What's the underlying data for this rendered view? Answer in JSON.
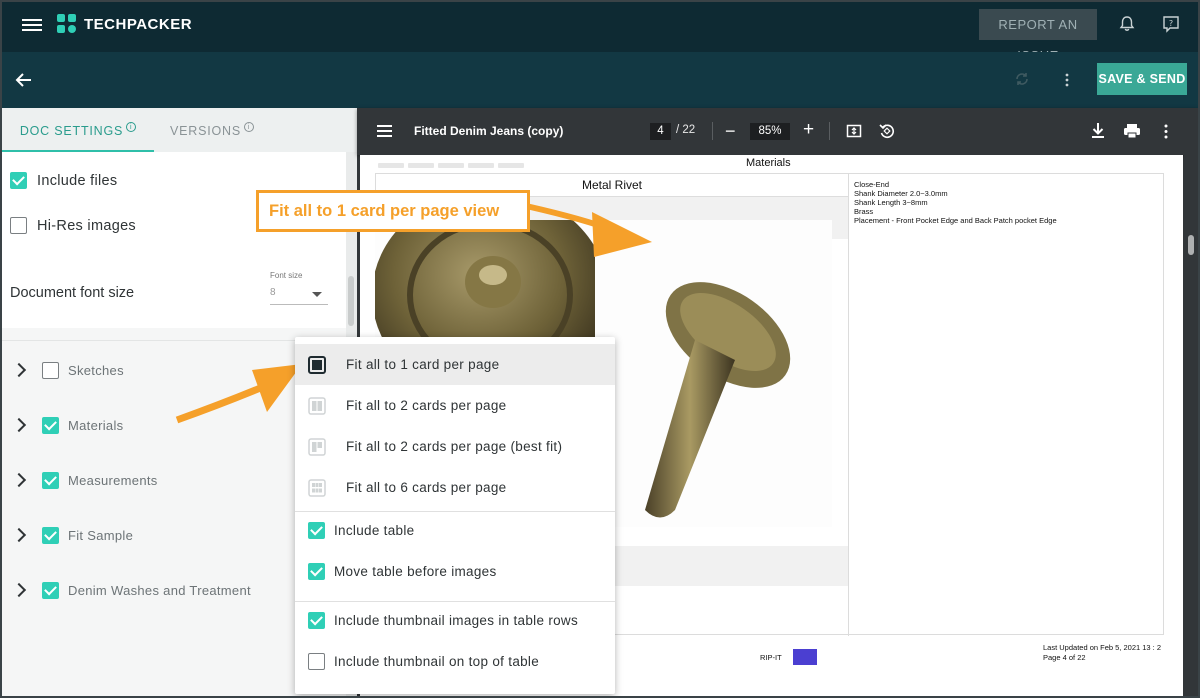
{
  "app": {
    "brand": "TECHPACKER",
    "report_label": "REPORT AN ISSUE",
    "save_label": "SAVE & SEND"
  },
  "tabs": [
    {
      "label": "DOC SETTINGS",
      "active": true
    },
    {
      "label": "VERSIONS",
      "active": false
    }
  ],
  "settings": {
    "include_files": {
      "label": "Include files",
      "checked": true
    },
    "hires_images": {
      "label": "Hi-Res images",
      "checked": false
    },
    "font_size_label": "Document font size",
    "font_size_caption": "Font size",
    "font_size_value": "8"
  },
  "sections": [
    {
      "label": "Sketches",
      "checked": false
    },
    {
      "label": "Materials",
      "checked": true
    },
    {
      "label": "Measurements",
      "checked": true
    },
    {
      "label": "Fit Sample",
      "checked": true
    },
    {
      "label": "Denim Washes and Treatment",
      "checked": true
    }
  ],
  "viewer": {
    "title": "Fitted Denim Jeans (copy)",
    "page_current": "4",
    "page_total": "/ 22",
    "zoom": "85%",
    "minus": "−",
    "plus": "+"
  },
  "document": {
    "section_title": "Materials",
    "item_name": "Metal Rivet",
    "specs": [
      "Close-End",
      "Shank Diameter 2.0~3.0mm",
      "Shank Length 3~8mm",
      "Brass",
      "Placement - Front Pocket Edge and Back Patch pocket Edge"
    ],
    "footer_brand": "RIP-IT",
    "footer_updated": "Last Updated on Feb 5, 2021 13 : 2",
    "footer_page": "Page 4 of 22"
  },
  "annotation": {
    "text": "Fit all to 1 card per page view",
    "color": "#f5a02a"
  },
  "dropdown": {
    "layouts": [
      {
        "label": "Fit all to 1 card per page",
        "selected": true
      },
      {
        "label": "Fit all to 2 cards per page",
        "selected": false
      },
      {
        "label": "Fit all to 2 cards per page (best fit)",
        "selected": false
      },
      {
        "label": "Fit all to 6 cards per page",
        "selected": false
      }
    ],
    "table_opts": [
      {
        "label": "Include table",
        "checked": true
      },
      {
        "label": "Move table before images",
        "checked": true
      }
    ],
    "thumb_opts": [
      {
        "label": "Include thumbnail images in table rows",
        "checked": true
      },
      {
        "label": "Include thumbnail on top of table",
        "checked": false
      }
    ]
  },
  "colors": {
    "topbar": "#0e2a33",
    "accent": "#2fcfb6",
    "save": "#3aa896"
  }
}
